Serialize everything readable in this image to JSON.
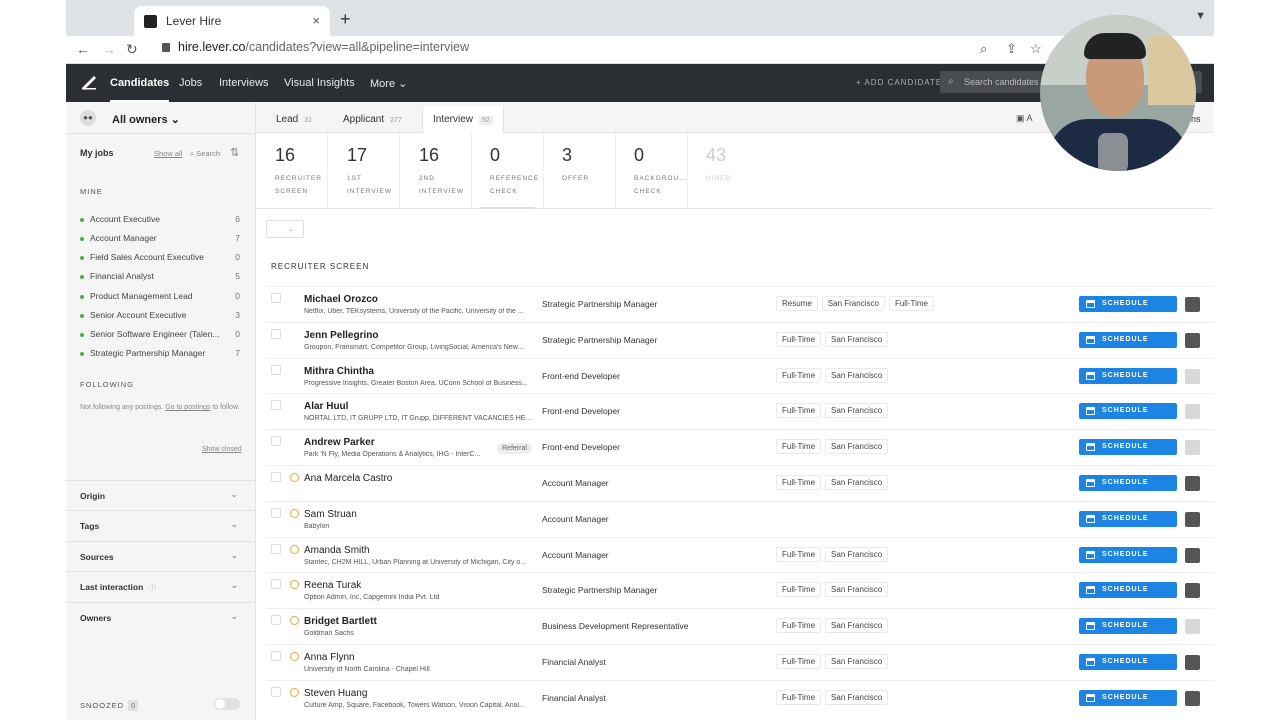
{
  "browser": {
    "tab_title": "Lever Hire",
    "close_icon": "×",
    "new_tab_icon": "+",
    "url_host": "hire.lever.co",
    "url_path": "/candidates?view=all&pipeline=interview"
  },
  "nav": {
    "items": [
      "Candidates",
      "Jobs",
      "Interviews",
      "Visual Insights",
      "More"
    ],
    "more_chevron": "⌄",
    "add_candidate": "+ ADD CANDIDATE",
    "search_placeholder": "Search candidates"
  },
  "sidebar": {
    "owners_label": "All owners ⌄",
    "my_jobs": "My jobs",
    "show_all": "Show all",
    "search": "Search",
    "mine_header": "MINE",
    "jobs": [
      {
        "label": "Account Executive",
        "count": "6"
      },
      {
        "label": "Account Manager",
        "count": "7"
      },
      {
        "label": "Field Sales Account Executive",
        "count": "0"
      },
      {
        "label": "Financial Analyst",
        "count": "5"
      },
      {
        "label": "Product Management Lead",
        "count": "0"
      },
      {
        "label": "Senior Account Executive",
        "count": "3"
      },
      {
        "label": "Senior Software Engineer (Talen...",
        "count": "0"
      },
      {
        "label": "Strategic Partnership Manager",
        "count": "7"
      }
    ],
    "following_header": "FOLLOWING",
    "following_text": "Not following any postings.",
    "following_link": "Go to postings",
    "following_suffix": "to follow.",
    "show_closed": "Show closed",
    "filters": [
      "Origin",
      "Tags",
      "Sources",
      "Last interaction",
      "Owners"
    ],
    "snoozed": "SNOOZED",
    "snoozed_count": "0"
  },
  "stages": {
    "tabs": [
      {
        "label": "Lead",
        "count": "31"
      },
      {
        "label": "Applicant",
        "count": "277"
      },
      {
        "label": "Interview",
        "count": "52"
      }
    ],
    "archive_label": "A",
    "options_label": "ons",
    "substages": [
      {
        "count": "16",
        "name1": "RECRUITER",
        "name2": "SCREEN"
      },
      {
        "count": "17",
        "name1": "1ST",
        "name2": "INTERVIEW"
      },
      {
        "count": "16",
        "name1": "2ND",
        "name2": "INTERVIEW"
      },
      {
        "count": "0",
        "name1": "REFERENCE",
        "name2": "CHECK"
      },
      {
        "count": "3",
        "name1": "OFFER",
        "name2": ""
      },
      {
        "count": "0",
        "name1": "BACKGROU...",
        "name2": "CHECK"
      },
      {
        "count": "43",
        "name1": "HIRED",
        "name2": ""
      }
    ]
  },
  "list": {
    "section_title": "RECRUITER SCREEN",
    "schedule_label": "SCHEDULE",
    "referral_label": "Referral",
    "candidates": [
      {
        "name": "Michael Orozco",
        "sub": "Netflix, Uber, TEKsystems, University of the Pacific, University of the ...",
        "position": "Strategic Partnership Manager",
        "tags": [
          "Resume",
          "San Francisco",
          "Full-Time"
        ]
      },
      {
        "name": "Jenn Pellegrino",
        "sub": "Groupon, Fransmart, Competitor Group, LivingSocial, America's New...",
        "position": "Strategic Partnership Manager",
        "tags": [
          "Full-Time",
          "San Francisco"
        ]
      },
      {
        "name": "Mithra Chintha",
        "sub": "Progressive Insights, Greater Boston Area, UConn School of Business...",
        "position": "Front-end Developer",
        "tags": [
          "Full-Time",
          "San Francisco"
        ]
      },
      {
        "name": "Alar Huul",
        "sub": "NORTAL LTD, IT GRUPP LTD, IT Grupp, DIFFERENT VACANCIES HELD IN ...",
        "position": "Front-end Developer",
        "tags": [
          "Full-Time",
          "San Francisco"
        ]
      },
      {
        "name": "Andrew Parker",
        "sub": "Park 'N Fly, Media Operations & Analytics, IHG - InterC...",
        "position": "Front-end Developer",
        "tags": [
          "Full-Time",
          "San Francisco"
        ]
      },
      {
        "name": "Ana Marcela Castro",
        "sub": "",
        "position": "Account Manager",
        "tags": [
          "Full-Time",
          "San Francisco"
        ]
      },
      {
        "name": "Sam Struan",
        "sub": "Babylon",
        "position": "Account Manager",
        "tags": []
      },
      {
        "name": "Amanda Smith",
        "sub": "Stantec, CH2M HILL, Urban Planning at University of Michigan, City o...",
        "position": "Account Manager",
        "tags": [
          "Full-Time",
          "San Francisco"
        ]
      },
      {
        "name": "Reena Turak",
        "sub": "Option Admin, Inc, Capgemini India Pvt. Ltd",
        "position": "Strategic Partnership Manager",
        "tags": [
          "Full-Time",
          "San Francisco"
        ]
      },
      {
        "name": "Bridget Bartlett",
        "sub": "Goldman Sachs",
        "position": "Business Development Representative",
        "tags": [
          "Full-Time",
          "San Francisco"
        ]
      },
      {
        "name": "Anna Flynn",
        "sub": "University of North Carolina - Chapel Hill",
        "position": "Financial Analyst",
        "tags": [
          "Full-Time",
          "San Francisco"
        ]
      },
      {
        "name": "Steven Huang",
        "sub": "Culture Amp, Square, Facebook, Towers Watson, Vision Capital, Anal...",
        "position": "Financial Analyst",
        "tags": [
          "Full-Time",
          "San Francisco"
        ]
      }
    ]
  }
}
